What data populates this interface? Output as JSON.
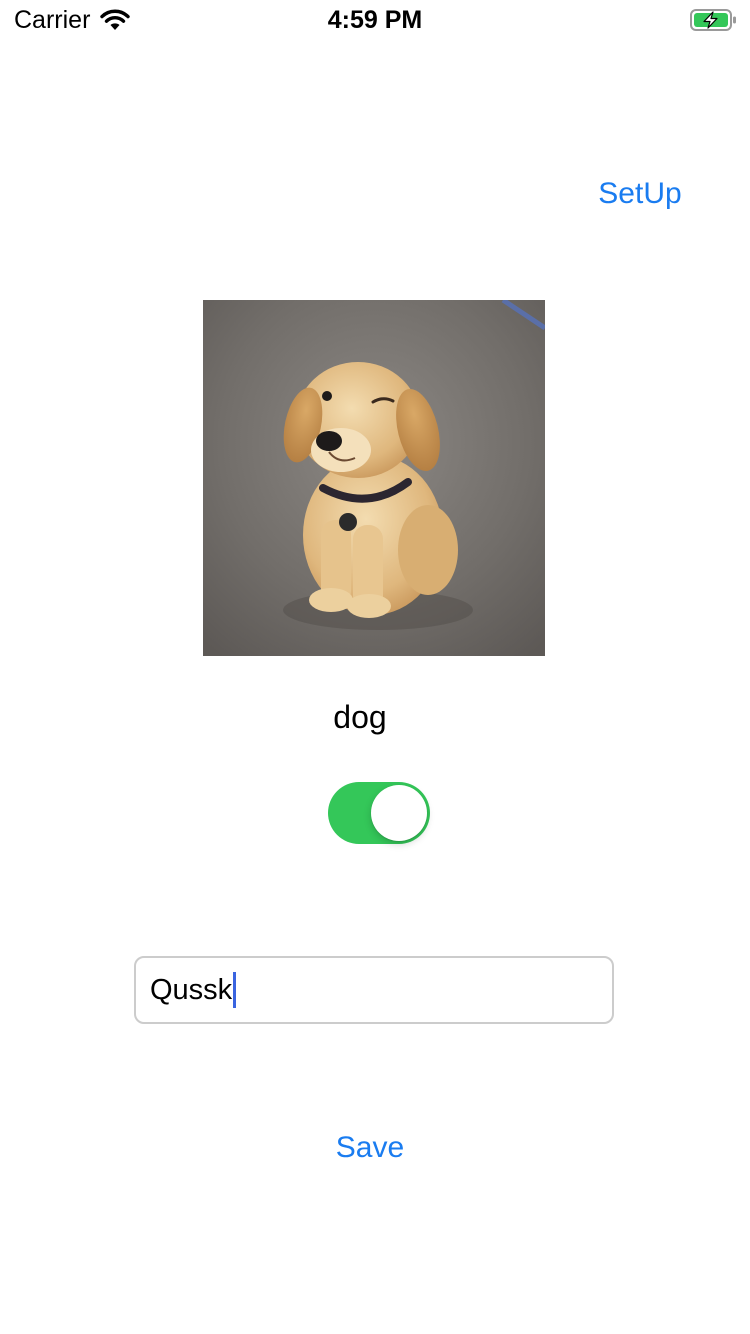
{
  "status_bar": {
    "carrier": "Carrier",
    "time": "4:59 PM",
    "battery_charging": true
  },
  "nav": {
    "setup_label": "SetUp"
  },
  "photo": {
    "subject": "golden retriever puppy"
  },
  "caption": "dog",
  "toggle": {
    "on": true
  },
  "name_input": {
    "value": "Qussk"
  },
  "actions": {
    "save_label": "Save"
  },
  "colors": {
    "link": "#1a7cf0",
    "toggle_on": "#34c759",
    "battery": "#34c759",
    "cursor": "#3a64e0"
  }
}
